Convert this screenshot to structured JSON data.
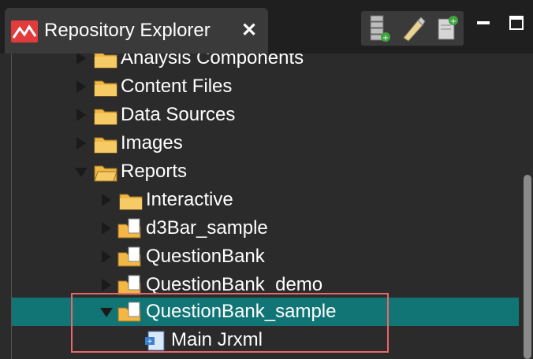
{
  "tab": {
    "title": "Repository Explorer",
    "close": "✕"
  },
  "toolbar": {
    "icons": [
      "new-server-icon",
      "edit-icon",
      "new-file-icon",
      "minimize-icon",
      "maximize-icon"
    ]
  },
  "colors": {
    "selection": "#127575",
    "highlight_border": "#e8686a",
    "folder": "#f2b745"
  },
  "tree": {
    "rows": [
      {
        "label": "Analysis Components",
        "expanded": false,
        "selected": false
      },
      {
        "label": "Content Files",
        "expanded": false,
        "selected": false
      },
      {
        "label": "Data Sources",
        "expanded": false,
        "selected": false
      },
      {
        "label": "Images",
        "expanded": false,
        "selected": false
      },
      {
        "label": "Reports",
        "expanded": true,
        "selected": false
      },
      {
        "label": "Interactive",
        "expanded": false,
        "selected": false
      },
      {
        "label": "d3Bar_sample",
        "expanded": false,
        "selected": false
      },
      {
        "label": "QuestionBank",
        "expanded": false,
        "selected": false
      },
      {
        "label": "QuestionBank_demo",
        "expanded": false,
        "selected": false
      },
      {
        "label": "QuestionBank_sample",
        "expanded": true,
        "selected": true
      },
      {
        "label": "Main Jrxml",
        "expanded": false,
        "selected": false
      }
    ]
  }
}
